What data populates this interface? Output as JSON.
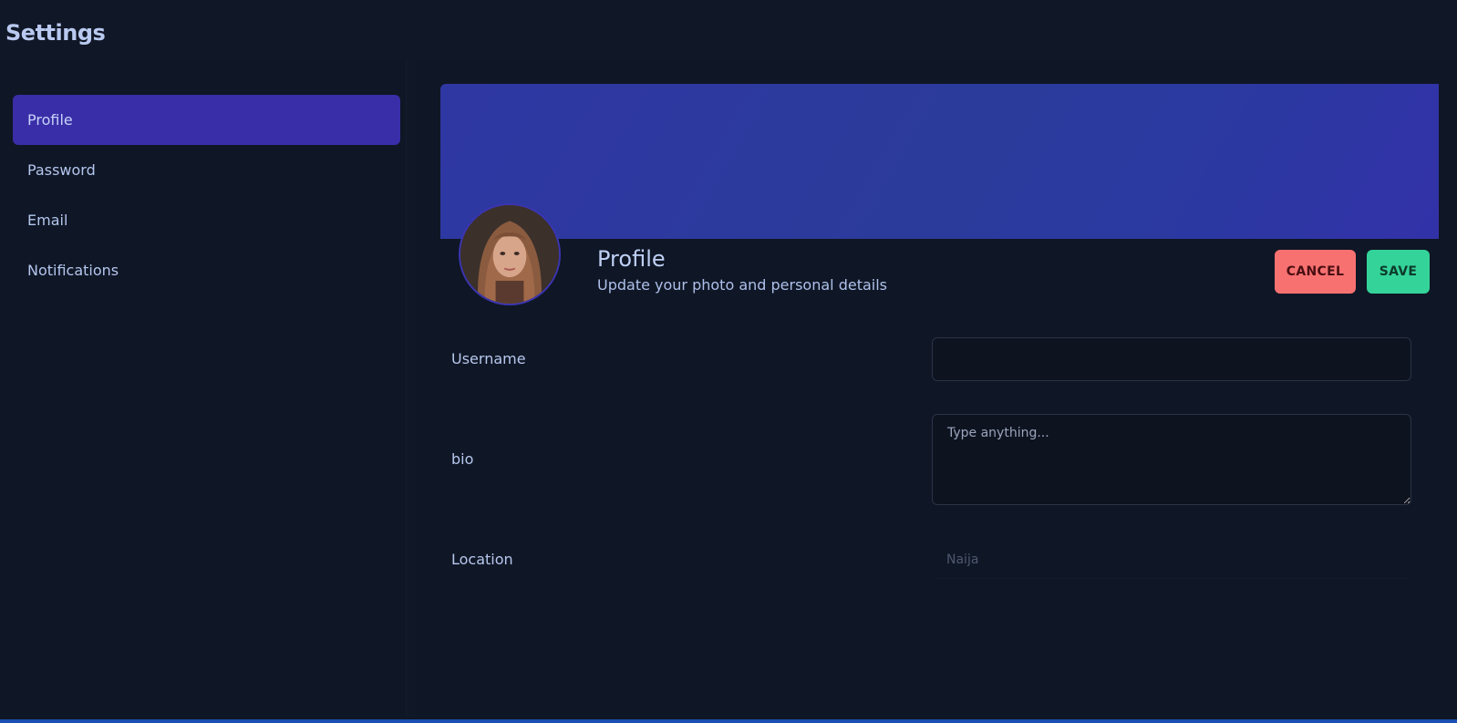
{
  "page": {
    "title": "Settings"
  },
  "sidebar": {
    "items": [
      {
        "label": "Profile",
        "active": true
      },
      {
        "label": "Password",
        "active": false
      },
      {
        "label": "Email",
        "active": false
      },
      {
        "label": "Notifications",
        "active": false
      }
    ]
  },
  "profile": {
    "title": "Profile",
    "subtitle": "Update your photo and personal details",
    "cancel_label": "CANCEL",
    "save_label": "SAVE"
  },
  "form": {
    "username": {
      "label": "Username",
      "value": "",
      "placeholder": ""
    },
    "bio": {
      "label": "bio",
      "value": "",
      "placeholder": "Type anything..."
    },
    "location": {
      "label": "Location",
      "value": "",
      "placeholder": "Naija"
    }
  },
  "colors": {
    "accent": "#3a2ea8",
    "banner": "#2f37a3",
    "cancel": "#f87171",
    "save": "#34d399",
    "background": "#0f1625"
  }
}
